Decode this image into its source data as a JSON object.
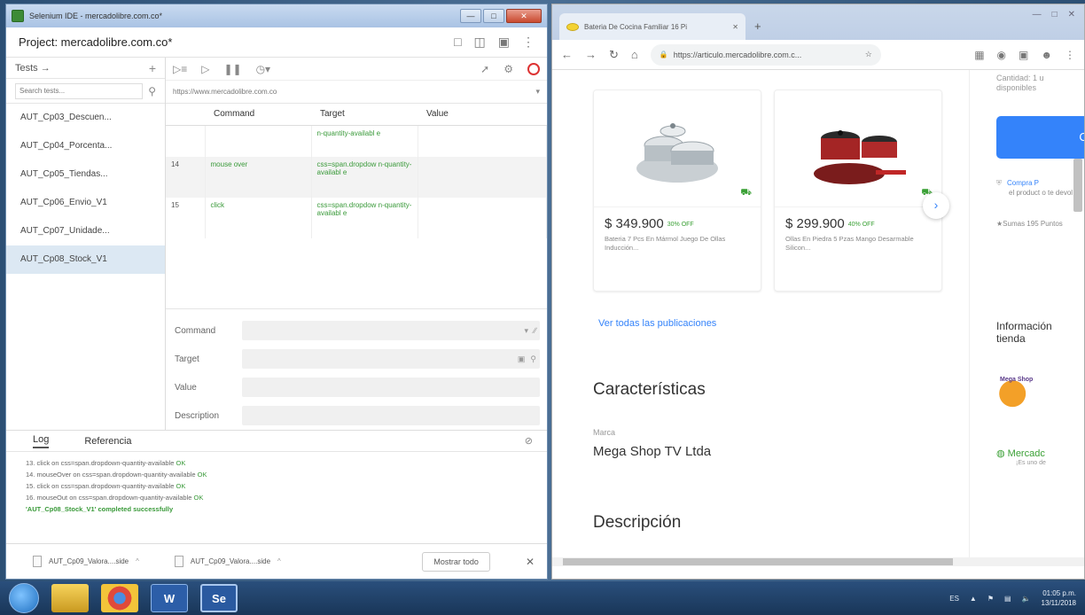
{
  "ide": {
    "window_title": "Selenium IDE - mercadolibre.com.co*",
    "project_title": "Project: mercadolibre.com.co*",
    "tests_label": "Tests →",
    "search_placeholder": "Search tests...",
    "tests": [
      "AUT_Cp03_Descuen...",
      "AUT_Cp04_Porcenta...",
      "AUT_Cp05_Tiendas...",
      "AUT_Cp06_Envio_V1",
      "AUT_Cp07_Unidade...",
      "AUT_Cp08_Stock_V1"
    ],
    "base_url": "https://www.mercadolibre.com.co",
    "columns": {
      "command": "Command",
      "target": "Target",
      "value": "Value"
    },
    "rows": [
      {
        "num": "",
        "command": "",
        "target": "n-quantity-availabl e",
        "value": ""
      },
      {
        "num": "14",
        "command": "mouse over",
        "target": "css=span.dropdow n-quantity-availabl e",
        "value": ""
      },
      {
        "num": "15",
        "command": "click",
        "target": "css=span.dropdow n-quantity-availabl e",
        "value": ""
      }
    ],
    "editor": {
      "command": "Command",
      "target": "Target",
      "value": "Value",
      "description": "Description"
    },
    "log_tab": "Log",
    "reference_tab": "Referencia",
    "log_lines": [
      {
        "text": "13. click on css=span.dropdown-quantity-available ",
        "status": "OK"
      },
      {
        "text": "14. mouseOver on css=span.dropdown-quantity-available ",
        "status": "OK"
      },
      {
        "text": "15. click on css=span.dropdown-quantity-available ",
        "status": "OK"
      },
      {
        "text": "16. mouseOut on css=span.dropdown-quantity-available ",
        "status": "OK"
      }
    ],
    "log_success": "'AUT_Cp08_Stock_V1' completed successfully",
    "downloads": [
      "AUT_Cp09_Valora....side",
      "AUT_Cp09_Valora....side"
    ],
    "show_all": "Mostrar todo"
  },
  "chrome": {
    "tab_title": "Bateria De Cocina Familiar 16 Pi",
    "url": "https://articulo.mercadolibre.com.c...",
    "products": [
      {
        "price": "$ 349.900",
        "off": "30% OFF",
        "title": "Bateria 7 Pcs En Mármol Juego De Ollas Inducción..."
      },
      {
        "price": "$ 299.900",
        "off": "40% OFF",
        "title": "Ollas En Piedra 5 Pzas Mango Desarmable Silicon..."
      }
    ],
    "see_all": "Ver todas las publicaciones",
    "characteristics": "Características",
    "brand_label": "Marca",
    "brand_value": "Mega Shop TV Ltda",
    "description": "Descripción",
    "side": {
      "quantity": "Cantidad: 1 u",
      "available": "disponibles",
      "buy": "Co",
      "guarantee_link": "Compra P",
      "guarantee_text": "el product o te devol",
      "points": "Sumas 195 Puntos",
      "info_title": "Información tienda",
      "store_logo": "Mega Shop",
      "leader": "Mercadc",
      "leader_sub": "¡Es uno de"
    }
  },
  "taskbar": {
    "time": "01:05 p.m.",
    "date": "13/11/2018",
    "word_label": "W",
    "se_label": "Se"
  }
}
